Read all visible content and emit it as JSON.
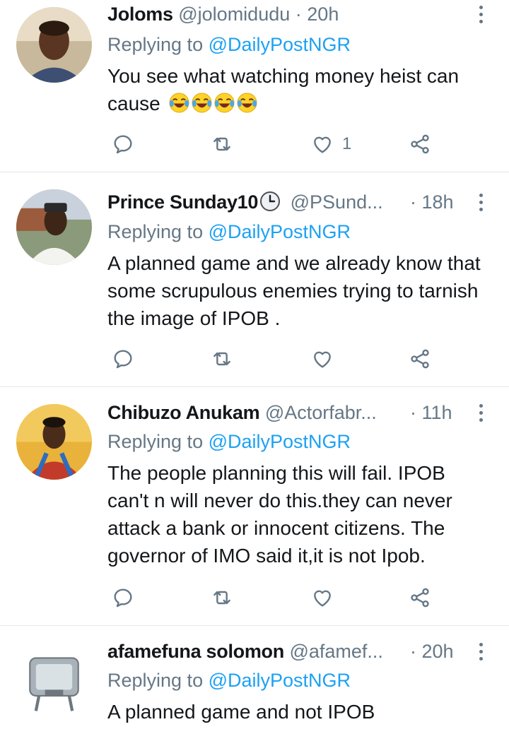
{
  "tweets": [
    {
      "name": "Joloms",
      "handle": "@jolomidudu",
      "dot": "·",
      "time": "20h",
      "replying_prefix": "Replying to",
      "replying_to": "@DailyPostNGR",
      "text": "You see what watching money heist can cause",
      "emoji": [
        "face-with-tears-of-joy",
        "face-with-tears-of-joy",
        "face-with-tears-of-joy",
        "face-with-tears-of-joy"
      ],
      "like_count": "1"
    },
    {
      "name": "Prince Sunday10",
      "name_icon": "clock-icon",
      "handle": "@PSund...",
      "dot": "·",
      "time": "18h",
      "replying_prefix": "Replying to",
      "replying_to": "@DailyPostNGR",
      "text": "A planned game and we already know that some scrupulous enemies trying to tarnish the image of IPOB .",
      "like_count": ""
    },
    {
      "name": "Chibuzo Anukam",
      "handle": "@Actorfabr...",
      "dot": "·",
      "time": "11h",
      "replying_prefix": "Replying to",
      "replying_to": "@DailyPostNGR",
      "text": "The people planning this will fail. IPOB can't n will never do this.they can never attack a bank or innocent citizens. The governor of IMO said it,it is not Ipob.",
      "like_count": ""
    },
    {
      "name": "afamefuna solomon",
      "handle": "@afamef...",
      "dot": "·",
      "time": "20h",
      "replying_prefix": "Replying to",
      "replying_to": "@DailyPostNGR",
      "text": "A planned game and not IPOB",
      "like_count": ""
    }
  ],
  "colors": {
    "text": "#14171a",
    "muted": "#657786",
    "link": "#1da1f2",
    "divider": "#e1e8ed"
  }
}
